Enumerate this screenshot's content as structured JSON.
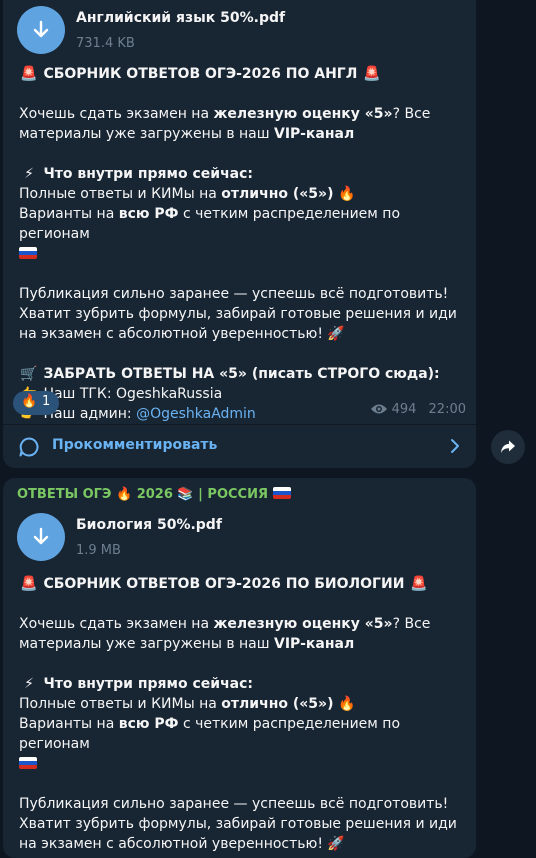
{
  "colors": {
    "background": "#0e1621",
    "bubble": "#182533",
    "accent_link": "#6ab3f3",
    "file_icon": "#5fa4e1",
    "channel_name": "#7bc862",
    "meta_gray": "#6d7f8f"
  },
  "message1": {
    "file": {
      "name": "Английский язык 50%.pdf",
      "size": "731.4 KB",
      "icon": "download-arrow-icon"
    },
    "title_emoji": "🚨",
    "title": "СБОРНИК ОТВЕТОВ ОГЭ-2026 ПО АНГЛ",
    "intro": {
      "part1": "Хочешь сдать экзамен на ",
      "bold1": "железную оценку «5»",
      "part2": "? Все материалы уже загружены в наш ",
      "bold2": "VIP-канал"
    },
    "inside": {
      "emoji": "⚡",
      "heading": "Что внутри прямо сейчас:",
      "line1_part1": "Полные ответы и КИМы на ",
      "line1_bold": "отлично («5»)",
      "line1_emoji": "🔥",
      "line2_part1": "Варианты на ",
      "line2_bold": "всю РФ",
      "line2_part2": " с четким распределением по регионам"
    },
    "publication": {
      "line1": "Публикация сильно заранее — успеешь всё подготовить!",
      "line2": "Хватит зубрить формулы, забирай готовые решения и иди на экзамен с абсолютной уверенностью!",
      "emoji": "🚀"
    },
    "cta": {
      "emoji": "🛒",
      "heading": "ЗАБРАТЬ ОТВЕТЫ НА «5» (писать СТРОГО сюда):",
      "pointer_emoji": "👉",
      "tgk_label": "Наш ТГК: OgeshkaRussia",
      "admin_label": "Наш админ: ",
      "admin_link": "@OgeshkaAdmin"
    },
    "reaction": {
      "emoji": "🔥",
      "count": "1"
    },
    "views": "494",
    "time": "22:00",
    "comment_label": "Прокомментировать"
  },
  "message2": {
    "channel": {
      "name_part1": "ОТВЕТЫ ОГЭ",
      "emoji1": "🔥",
      "year": "2026",
      "emoji2": "📚",
      "separator": "|",
      "region": "РОССИЯ"
    },
    "file": {
      "name": "Биология 50%.pdf",
      "size": "1.9 MB",
      "icon": "download-arrow-icon"
    },
    "title_emoji": "🚨",
    "title": "СБОРНИК ОТВЕТОВ ОГЭ-2026 ПО БИОЛОГИИ",
    "intro": {
      "part1": "Хочешь сдать экзамен на ",
      "bold1": "железную оценку «5»",
      "part2": "? Все материалы уже загружены в наш ",
      "bold2": "VIP-канал"
    },
    "inside": {
      "emoji": "⚡",
      "heading": "Что внутри прямо сейчас:",
      "line1_part1": "Полные ответы и КИМы на ",
      "line1_bold": "отлично («5»)",
      "line1_emoji": "🔥",
      "line2_part1": "Варианты на ",
      "line2_bold": "всю РФ",
      "line2_part2": " с четким распределением по регионам"
    },
    "publication": {
      "line1": "Публикация сильно заранее — успеешь всё подготовить!",
      "line2": "Хватит зубрить формулы, забирай готовые решения и иди на экзамен с абсолютной уверенностью!",
      "emoji": "🚀"
    }
  }
}
